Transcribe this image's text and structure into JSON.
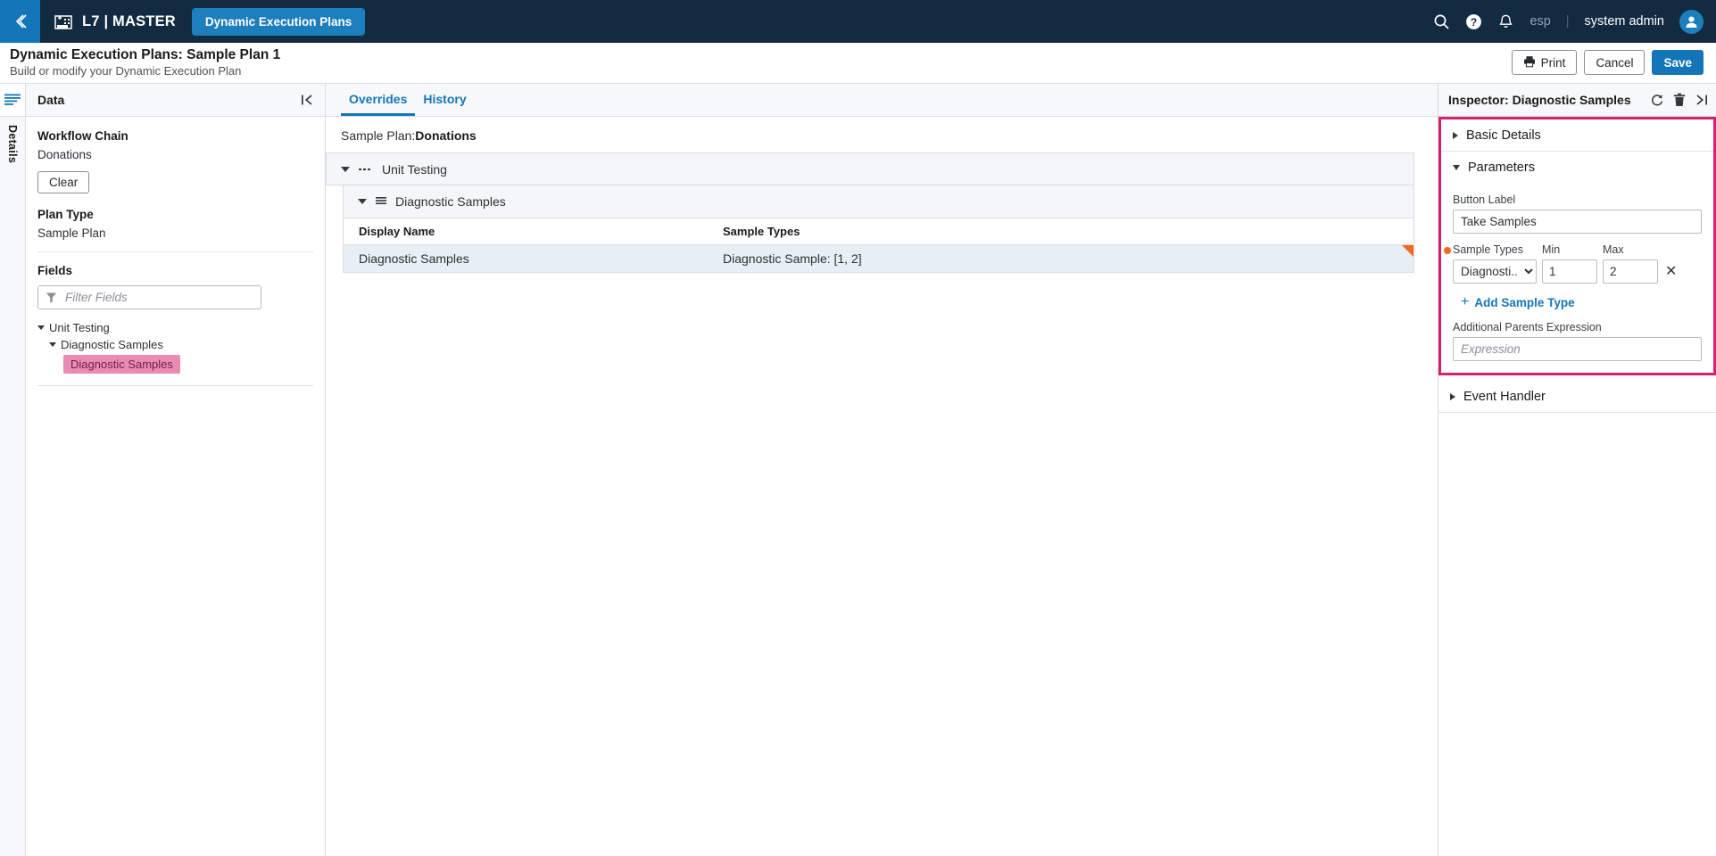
{
  "topnav": {
    "back_icon": "chevron-left-icon",
    "brand_icon": "building-add-icon",
    "brand": "L7 | MASTER",
    "active_tab": "Dynamic Execution Plans",
    "search_icon": "search-icon",
    "help_icon": "help-circle-icon",
    "notification_icon": "bell-icon",
    "tenant": "esp",
    "separator": "|",
    "user": "system admin",
    "avatar_icon": "user-avatar-icon"
  },
  "pagehead": {
    "title": "Dynamic Execution Plans: Sample Plan 1",
    "subtitle": "Build or modify your Dynamic Execution Plan",
    "print_label": "Print",
    "print_icon": "printer-icon",
    "cancel_label": "Cancel",
    "save_label": "Save"
  },
  "rail": {
    "menu_icon": "hamburger-menu-icon",
    "details_tab": "Details"
  },
  "leftpanel": {
    "header": "Data",
    "collapse_icon": "collapse-left-icon",
    "workflow_chain_label": "Workflow Chain",
    "workflow_chain_value": "Donations",
    "clear_label": "Clear",
    "plan_type_label": "Plan Type",
    "plan_type_value": "Sample Plan",
    "fields_label": "Fields",
    "filter_placeholder": "Filter Fields",
    "filter_value": "",
    "filter_icon": "funnel-icon",
    "tree": [
      {
        "label": "Unit Testing",
        "level": 1,
        "expanded": true,
        "selected": false
      },
      {
        "label": "Diagnostic Samples",
        "level": 2,
        "expanded": true,
        "selected": false
      },
      {
        "label": "Diagnostic Samples",
        "level": 3,
        "expanded": false,
        "selected": true
      }
    ]
  },
  "center": {
    "tabs": [
      {
        "label": "Overrides",
        "active": true
      },
      {
        "label": "History",
        "active": false
      }
    ],
    "breadcrumb_prefix": "Sample Plan:",
    "breadcrumb_value": "Donations",
    "workflow_rows": [
      {
        "label": "Unit Testing",
        "icon": "dots-horizontal-icon",
        "expanded": true
      },
      {
        "label": "Diagnostic Samples",
        "icon": "list-lines-icon",
        "expanded": true
      }
    ],
    "table": {
      "columns": [
        "Display Name",
        "Sample Types"
      ],
      "rows": [
        {
          "display_name": "Diagnostic Samples",
          "sample_types": "Diagnostic Sample: [1, 2]",
          "flagged": true
        }
      ]
    }
  },
  "inspector": {
    "title": "Inspector: Diagnostic Samples",
    "refresh_icon": "refresh-icon",
    "delete_icon": "trash-icon",
    "collapse_icon": "collapse-right-icon",
    "sections": [
      {
        "label": "Basic Details",
        "expanded": false
      },
      {
        "label": "Parameters",
        "expanded": true
      },
      {
        "label": "Event Handler",
        "expanded": false
      }
    ],
    "parameters": {
      "button_label_label": "Button Label",
      "button_label_value": "Take Samples",
      "button_label_placeholder": "",
      "sample_types_label": "Sample Types",
      "min_label": "Min",
      "max_label": "Max",
      "sample_type_value": "Diagnosti...",
      "min_value": "1",
      "max_value": "2",
      "remove_icon": "close-x-icon",
      "add_sample_type": "Add Sample Type",
      "additional_parents_label": "Additional Parents Expression",
      "additional_parents_placeholder": "Expression",
      "additional_parents_value": ""
    }
  },
  "colors": {
    "nav_bg": "#122b40",
    "accent_blue": "#1476b8",
    "highlight_pink": "#d6216f",
    "chip_pink": "#eb8ab4",
    "flag_orange": "#f26722",
    "row_selected": "#e7eff4"
  }
}
